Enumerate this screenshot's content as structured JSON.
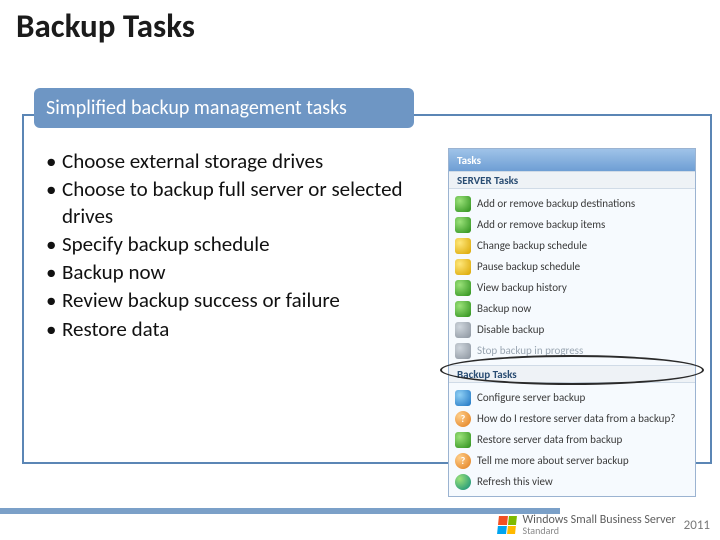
{
  "title": "Backup Tasks",
  "subtitle": "Simplified backup management tasks",
  "bullets": [
    "Choose external storage drives",
    "Choose to backup full server or selected drives",
    "Specify backup schedule",
    "Backup now",
    "Review backup success or failure",
    "Restore data"
  ],
  "pane": {
    "header": "Tasks",
    "section1_title": "SERVER Tasks",
    "section1": {
      "items": [
        {
          "label": "Add or remove backup destinations"
        },
        {
          "label": "Add or remove backup items"
        },
        {
          "label": "Change backup schedule"
        },
        {
          "label": "Pause backup schedule"
        },
        {
          "label": "View backup history"
        },
        {
          "label": "Backup now"
        },
        {
          "label": "Disable backup"
        },
        {
          "label": "Stop backup in progress"
        }
      ]
    },
    "section2_title": "Backup Tasks",
    "section2": {
      "items": [
        {
          "label": "Configure server backup"
        },
        {
          "label": "How do I restore server data from a backup?"
        },
        {
          "label": "Restore server data from backup"
        },
        {
          "label": "Tell me more about server backup"
        },
        {
          "label": "Refresh this view"
        }
      ]
    }
  },
  "brand": {
    "top": "Windows Small Business Server",
    "bottom": "Standard",
    "year": "2011"
  }
}
